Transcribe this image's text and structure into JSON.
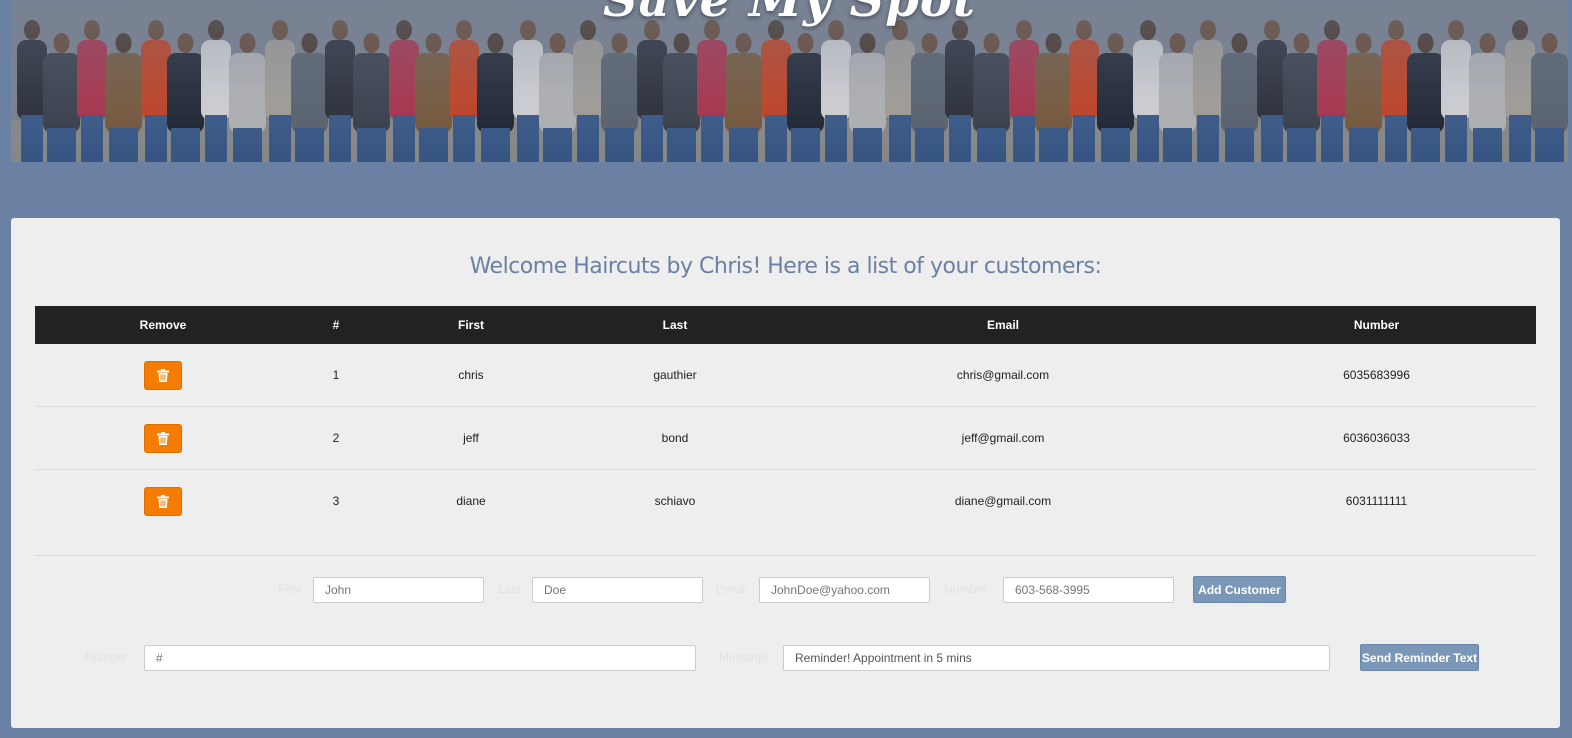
{
  "banner": {
    "logo_text": "Save My Spot"
  },
  "welcome": "Welcome Haircuts by Chris! Here is a list of your customers:",
  "table": {
    "headers": [
      "Remove",
      "#",
      "First",
      "Last",
      "Email",
      "Number"
    ],
    "rows": [
      {
        "num": "1",
        "first": "chris",
        "last": "gauthier",
        "email": "chris@gmail.com",
        "number": "6035683996"
      },
      {
        "num": "2",
        "first": "jeff",
        "last": "bond",
        "email": "jeff@gmail.com",
        "number": "6036036033"
      },
      {
        "num": "3",
        "first": "diane",
        "last": "schiavo",
        "email": "diane@gmail.com",
        "number": "6031111111"
      }
    ]
  },
  "add_form": {
    "first_label": "First",
    "first_placeholder": "John",
    "last_label": "Last",
    "last_placeholder": "Doe",
    "email_label": "Email",
    "email_placeholder": "JohnDoe@yahoo.com",
    "number_label": "Number",
    "number_placeholder": "603-568-3995",
    "submit_label": "Add Customer"
  },
  "reminder_form": {
    "number_label": "Number",
    "number_placeholder": "#",
    "message_label": "Message",
    "message_value": "Reminder! Appointment in 5 mins",
    "submit_label": "Send Reminder Text"
  },
  "colors": {
    "background": "#6a81a3",
    "panel": "#eeeeee",
    "table_header": "#222222",
    "delete_button": "#f57c00",
    "action_button": "#7b97b8",
    "heading": "#6a81a3"
  },
  "icons": {
    "remove": "trash-icon"
  }
}
